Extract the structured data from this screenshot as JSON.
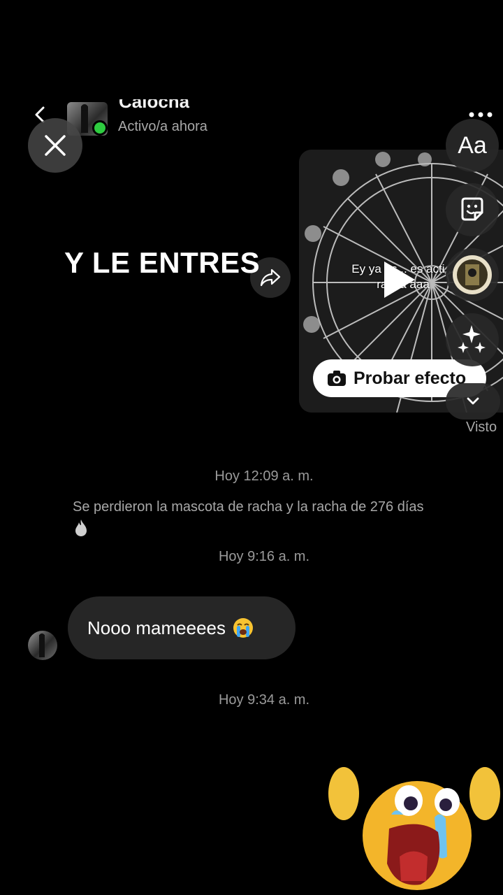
{
  "header": {
    "contact_name": "Calocha",
    "status": "Activo/a ahora"
  },
  "story_editor": {
    "text_tool_label": "Aa",
    "overlay_text": "Y LE ENTRES"
  },
  "shared_post": {
    "caption": "Ey ya es... es acti... racha aaa",
    "try_effect_label": "Probar efecto"
  },
  "seen_label": "Visto",
  "chat": {
    "timestamp_1": "Hoy 12:09 a. m.",
    "system_message": "Se perdieron la mascota de racha y la racha de 276 días",
    "timestamp_2": "Hoy 9:16 a. m.",
    "message_text": "Nooo mameeees",
    "timestamp_3": "Hoy 9:34 a. m."
  },
  "colors": {
    "background": "#000000",
    "bubble": "#262626",
    "online": "#2ecc40",
    "muted_text": "#a8a8a8"
  }
}
